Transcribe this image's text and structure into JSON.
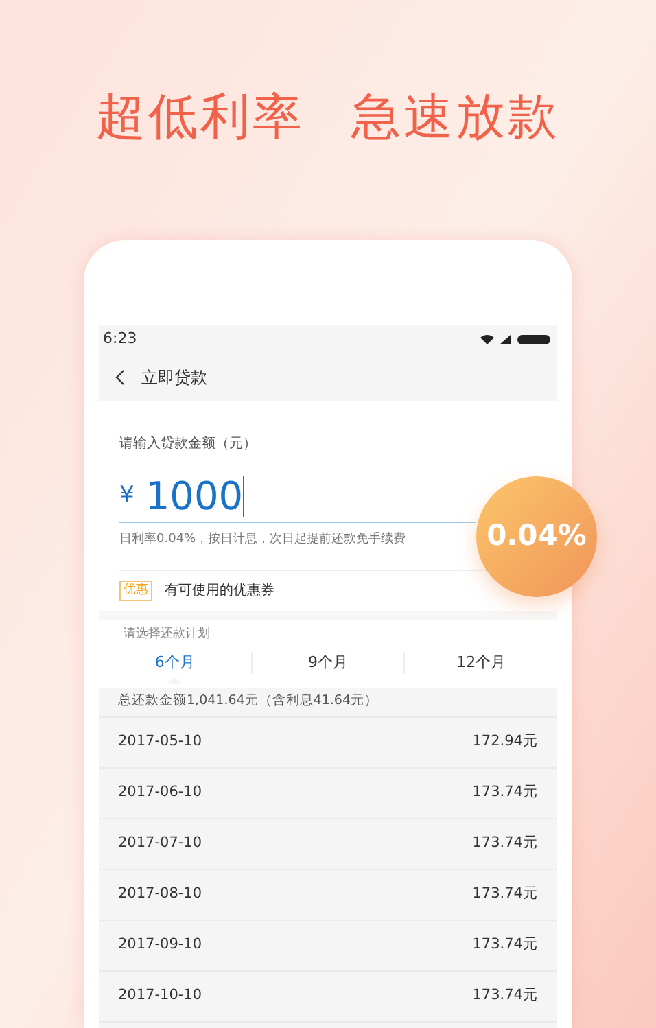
{
  "headline": [
    "超低利率",
    "急速放款"
  ],
  "status_bar": {
    "time": "6:23"
  },
  "nav": {
    "title": "立即贷款"
  },
  "amount": {
    "label": "请输入贷款金额（元）",
    "currency": "¥",
    "value": "1000",
    "note": "日利率0.04%，按日计息，次日起提前还款免手续费"
  },
  "coupon": {
    "tag": "优惠",
    "text": "有可使用的优惠券"
  },
  "plan": {
    "label": "请选择还款计划",
    "tabs": [
      {
        "label": "6个月",
        "selected": true
      },
      {
        "label": "9个月",
        "selected": false
      },
      {
        "label": "12个月",
        "selected": false
      }
    ],
    "summary": "总还款金额1,041.64元（含利息41.64元）",
    "rows": [
      {
        "date": "2017-05-10",
        "amount": "172.94元"
      },
      {
        "date": "2017-06-10",
        "amount": "173.74元"
      },
      {
        "date": "2017-07-10",
        "amount": "173.74元"
      },
      {
        "date": "2017-08-10",
        "amount": "173.74元"
      },
      {
        "date": "2017-09-10",
        "amount": "173.74元"
      },
      {
        "date": "2017-10-10",
        "amount": "173.74元"
      }
    ]
  },
  "badge": {
    "text": "0.04%"
  }
}
